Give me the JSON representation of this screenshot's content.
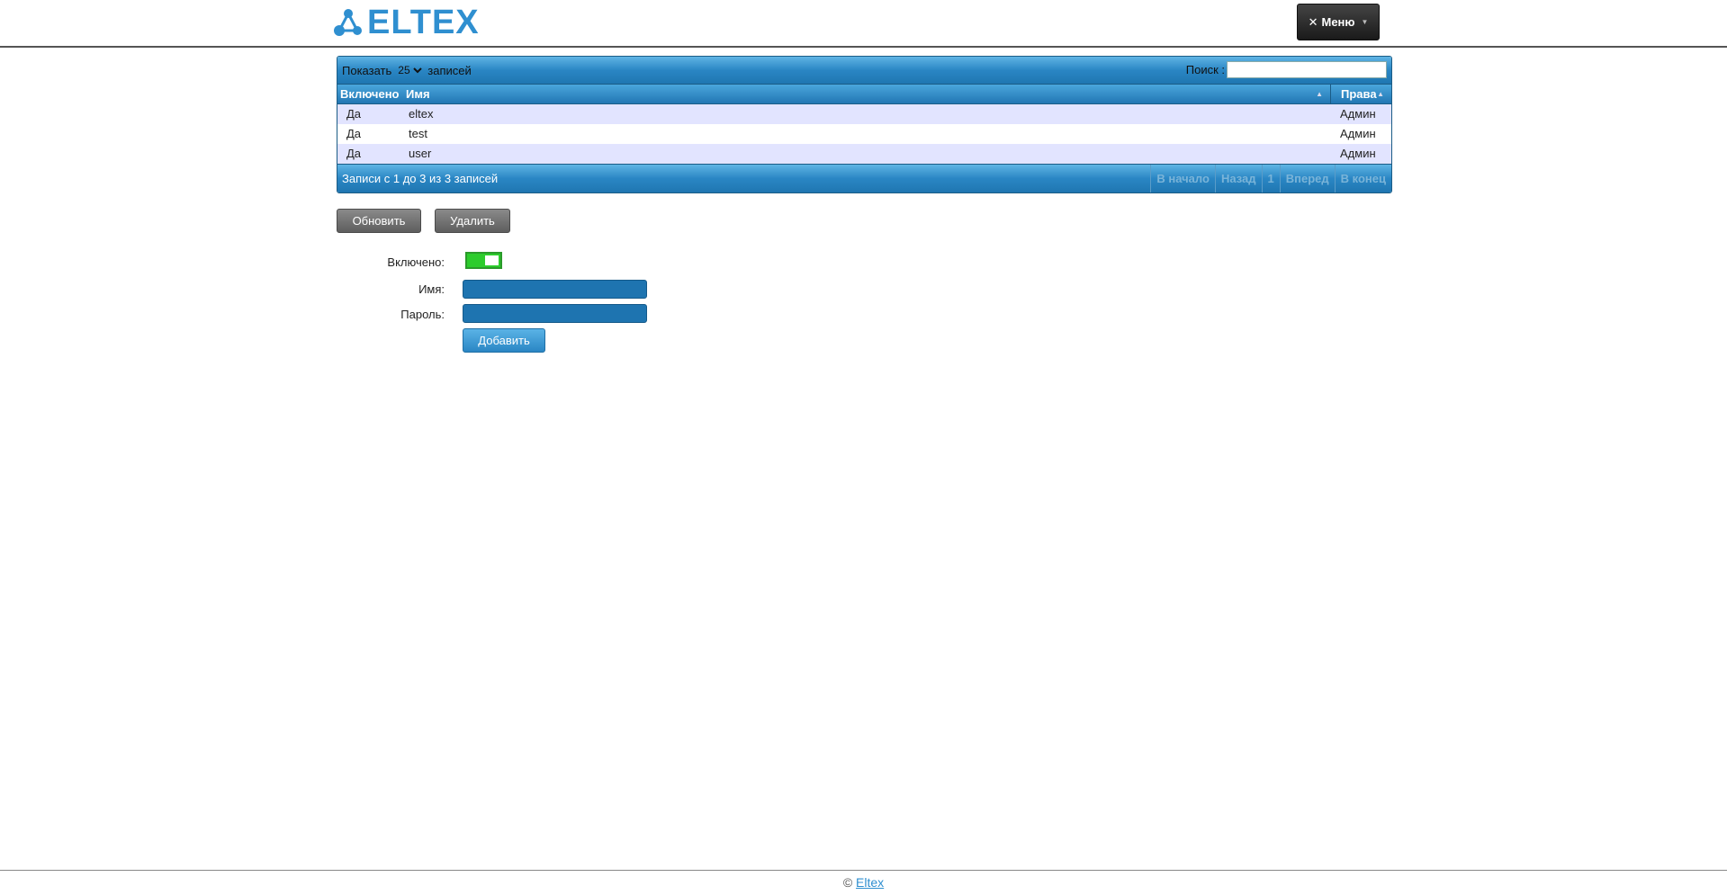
{
  "header": {
    "logo_text": "ELTEX",
    "menu_label": "Меню",
    "menu_icon": "tools-icon"
  },
  "table": {
    "length_label": "Показать",
    "length_value": "25",
    "length_options": [
      "25"
    ],
    "records_label": "записей",
    "search_label": "Поиск :",
    "search_value": "",
    "columns": [
      "Включено",
      "Имя",
      "Права"
    ],
    "rows": [
      {
        "enabled": "Да",
        "name": "eltex",
        "rights": "Админ"
      },
      {
        "enabled": "Да",
        "name": "test",
        "rights": "Админ"
      },
      {
        "enabled": "Да",
        "name": "user",
        "rights": "Админ"
      }
    ],
    "info": "Записи с 1 до 3 из 3 записей",
    "pager": {
      "first": "В начало",
      "prev": "Назад",
      "page": "1",
      "next": "Вперед",
      "last": "В конец"
    }
  },
  "actions": {
    "refresh_label": "Обновить",
    "delete_label": "Удалить"
  },
  "form": {
    "enabled_label": "Включено:",
    "enabled_state": "on",
    "name_label": "Имя:",
    "name_value": "",
    "password_label": "Пароль:",
    "password_value": "",
    "add_label": "Добавить"
  },
  "footer": {
    "copyright": "©",
    "link_text": "Eltex"
  },
  "colors": {
    "brand": "#2f8fd0",
    "header_bar": "#2a86c4",
    "odd_row": "#e2e4ff",
    "toggle_on": "#2ccc2c"
  }
}
